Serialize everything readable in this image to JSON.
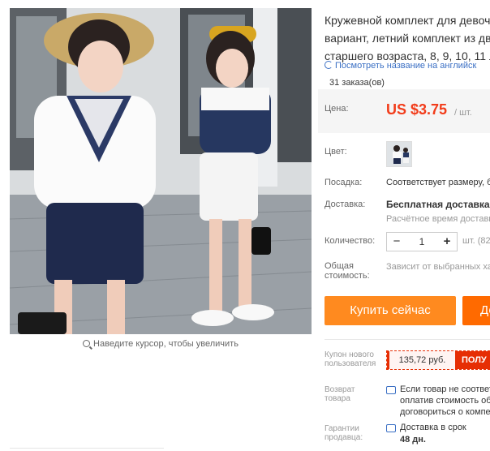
{
  "image": {
    "zoom_hint": "Наведите курсор, чтобы увеличить"
  },
  "product": {
    "title_lines": [
      "Кружевной комплект для девоче",
      "вариант, летний комплект из дву",
      "старшего возраста, 8, 9, 10, 11 ле"
    ],
    "translate_link": "Посмотреть название на английск",
    "orders": "31 заказа(ов)"
  },
  "price": {
    "label": "Цена:",
    "value": "US $3.75",
    "unit": "/ шт."
  },
  "color": {
    "label": "Цвет:"
  },
  "fit": {
    "label": "Посадка:",
    "value": "Соответствует размеру, б"
  },
  "shipping": {
    "label": "Доставка:",
    "value": "Бесплатная доставка в",
    "estimate": "Расчётное время доставк"
  },
  "quantity": {
    "label": "Количество:",
    "minus": "−",
    "value": "1",
    "plus": "+",
    "unit": "шт. (82"
  },
  "total": {
    "label": "Общая стоимость:",
    "value": "Зависит от выбранных ха"
  },
  "buttons": {
    "buy_now": "Купить сейчас",
    "add_to_cart": "До"
  },
  "coupon": {
    "label": "Купон нового пользователя",
    "amount": "135,72 руб.",
    "get": "ПОЛУ"
  },
  "returns": {
    "label": "Возврат товара",
    "lines": [
      "Если товар не соответ",
      "оплатив стоимость об",
      "договориться о компе"
    ]
  },
  "guarantee": {
    "label": "Гарантии продавца:",
    "line1": "Доставка в срок",
    "line2": "48 дн."
  },
  "colors": {
    "price_red": "#f23c1a",
    "buy_orange": "#ff8a1f",
    "cart_orange": "#ff6a00",
    "coupon_red": "#e62e04",
    "link_blue": "#3a6fc4"
  }
}
